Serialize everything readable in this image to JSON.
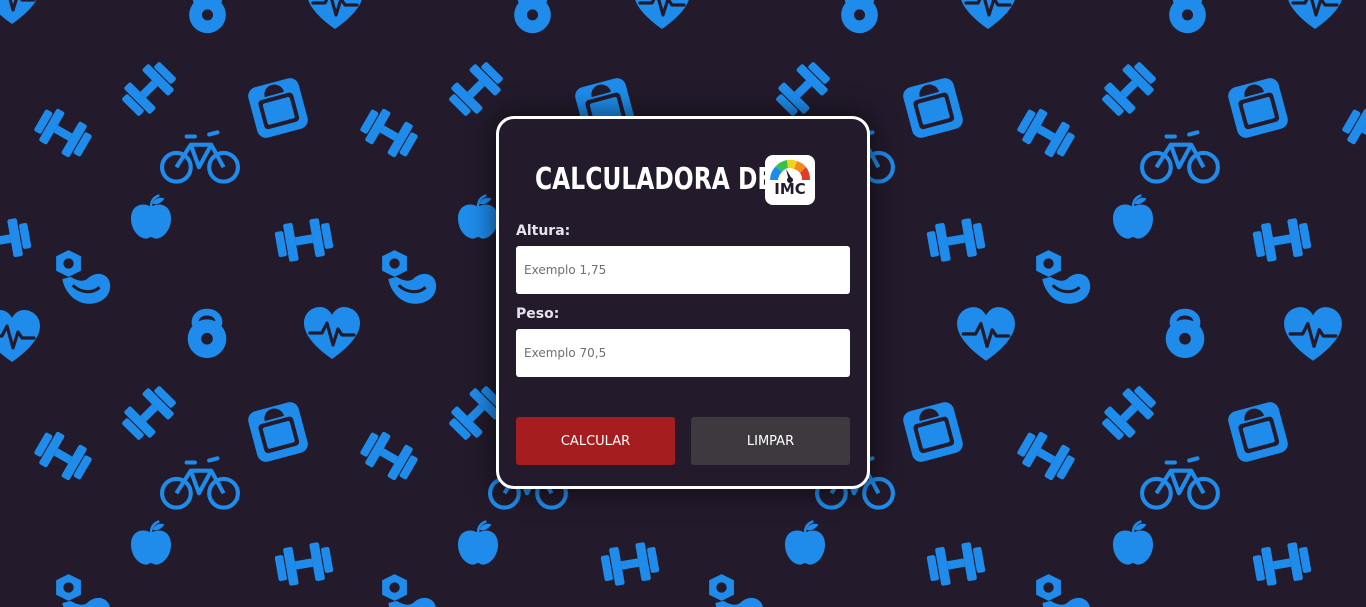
{
  "title": "CALCULADORA DE",
  "logo": {
    "text": "IMC"
  },
  "form": {
    "height_label": "Altura:",
    "height_placeholder": "Exemplo 1,75",
    "weight_label": "Peso:",
    "weight_placeholder": "Exemplo 70,5",
    "calculate_label": "CALCULAR",
    "clear_label": "LIMPAR"
  },
  "colors": {
    "background": "#231a2b",
    "pattern_icons": "#1f8ceb",
    "calculate_button": "#a51d1f",
    "clear_button": "#3d393e"
  },
  "background_icons": [
    "heart-pulse-icon",
    "kettlebell-icon",
    "dumbbell-icon",
    "scale-icon",
    "bicycle-icon",
    "apple-icon",
    "bicep-icon"
  ]
}
